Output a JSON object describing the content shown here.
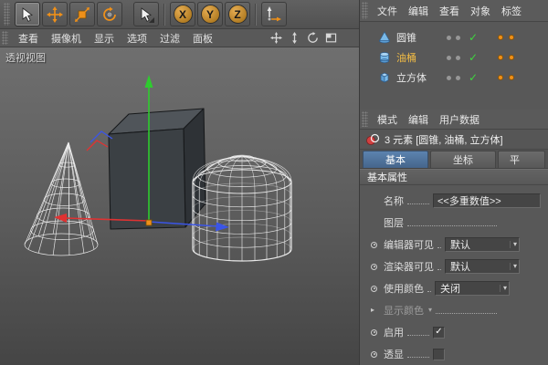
{
  "colors": {
    "accent": "#ef9019",
    "axis_x": "#e03232",
    "axis_y": "#2ecc2e",
    "axis_z": "#3b55e6",
    "tab_active": "#4d6f99",
    "check_green": "#3fd43f",
    "object_icon_blue": "#79b9e8"
  },
  "top_toolbar": {
    "axis_buttons": [
      "X",
      "Y",
      "Z"
    ]
  },
  "viewport": {
    "label": "透视视图",
    "menu": [
      "查看",
      "摄像机",
      "显示",
      "选项",
      "过滤",
      "面板"
    ]
  },
  "object_manager": {
    "menu": [
      "文件",
      "编辑",
      "查看",
      "对象",
      "标签"
    ],
    "objects": [
      {
        "name": "圆锥",
        "type": "cone",
        "enabled": "✓"
      },
      {
        "name": "油桶",
        "type": "tank",
        "enabled": "✓"
      },
      {
        "name": "立方体",
        "type": "cube",
        "enabled": "✓"
      }
    ]
  },
  "attribute_manager": {
    "menu": [
      "模式",
      "编辑",
      "用户数据"
    ],
    "selection_info": "3 元素 [圆锥, 油桶, 立方体]",
    "tabs": [
      "基本",
      "坐标",
      "平"
    ],
    "section_title": "基本属性",
    "fields": {
      "name_label": "名称",
      "name_value": "<<多重数值>>",
      "layer_label": "图层",
      "editor_vis_label": "编辑器可见",
      "editor_vis_value": "默认",
      "render_vis_label": "渲染器可见",
      "render_vis_value": "默认",
      "use_color_label": "使用颜色",
      "use_color_value": "关闭",
      "display_color_label": "显示颜色",
      "enabled_label": "启用",
      "enabled_check": "✓",
      "xray_label": "透显"
    }
  }
}
